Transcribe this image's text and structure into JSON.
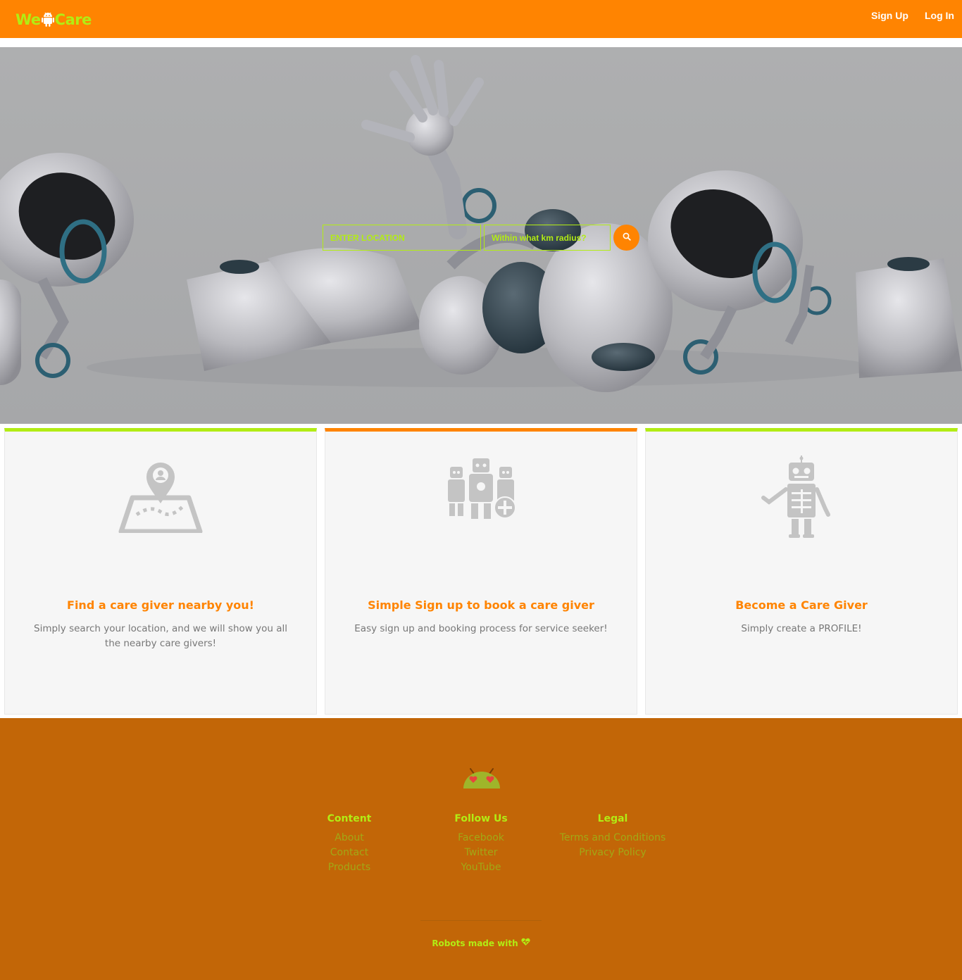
{
  "colors": {
    "primary": "#ff8401",
    "accent": "#b2ec14",
    "footer": "#c26607",
    "muted_link": "#a2a816",
    "card_text": "#777777",
    "icon_gray": "#c4c4c4"
  },
  "navbar": {
    "brand_prefix": "We",
    "brand_icon": "android-icon",
    "brand_suffix": "Care",
    "links": [
      {
        "label": "Sign Up"
      },
      {
        "label": "Log In"
      }
    ]
  },
  "hero": {
    "image": "waving-robots-illustration",
    "search": {
      "location_placeholder": "ENTER LOCATION",
      "radius_placeholder": "Within what km radius?",
      "button_icon": "search-icon"
    }
  },
  "features": [
    {
      "icon": "map-pin-icon",
      "title": "Find a care giver nearby you!",
      "text": "Simply search your location, and we will show you all the nearby care givers!"
    },
    {
      "icon": "robot-group-plus-icon",
      "title": "Simple Sign up to book a care giver",
      "text": "Easy sign up and booking process for service seeker!"
    },
    {
      "icon": "robot-waving-icon",
      "title": "Become a Care Giver",
      "text": "Simply create a PROFILE!"
    }
  ],
  "footer": {
    "logo": "android-heart-eyes-icon",
    "columns": [
      {
        "heading": "Content",
        "links": [
          "About",
          "Contact",
          "Products"
        ]
      },
      {
        "heading": "Follow Us",
        "links": [
          "Facebook",
          "Twitter",
          "YouTube"
        ]
      },
      {
        "heading": "Legal",
        "links": [
          "Terms and Conditions",
          "Privacy Policy"
        ]
      }
    ],
    "credit": "Robots made with",
    "credit_icon": "heart-icon"
  }
}
